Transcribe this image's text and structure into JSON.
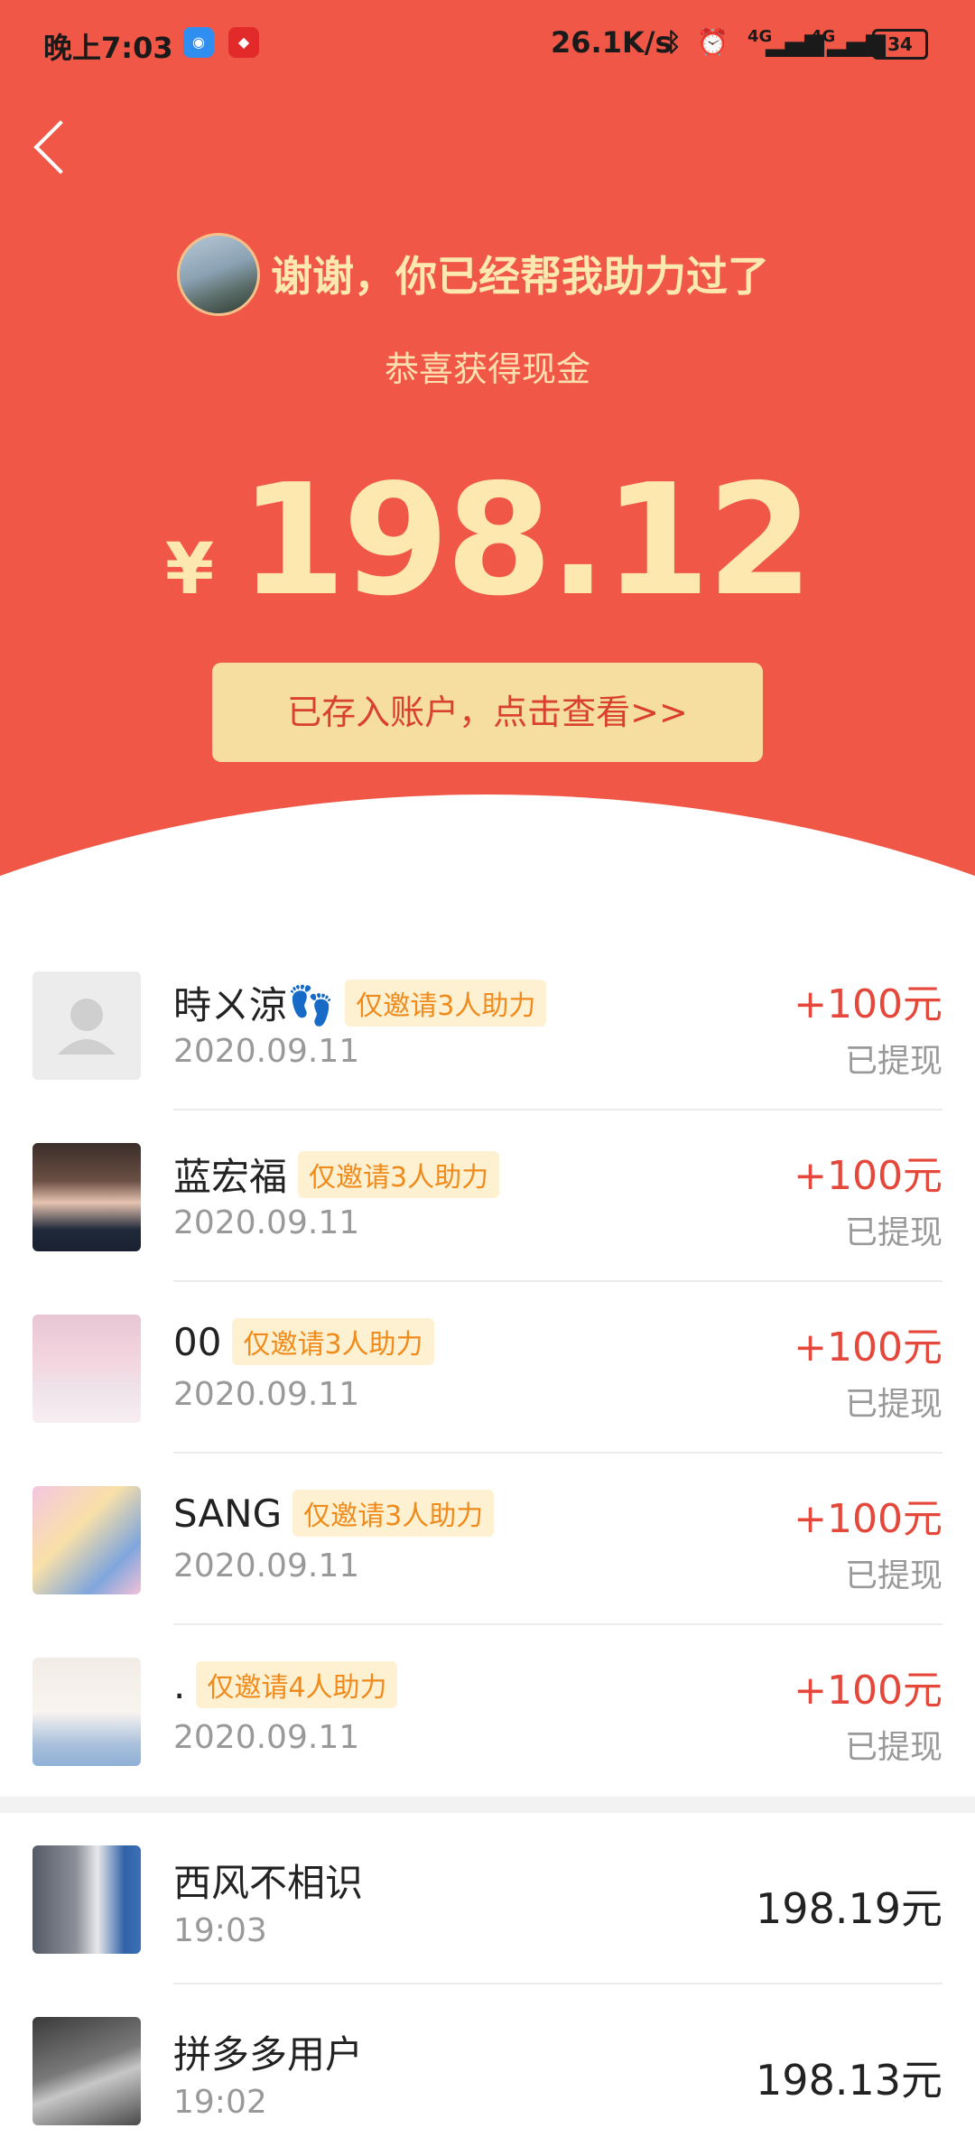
{
  "status_bar": {
    "time": "晚上7:03",
    "speed": "26.1K/s",
    "bluetooth": "bluetooth-icon",
    "alarm": "alarm-icon",
    "network1": "4G",
    "network2": "4G",
    "battery": "34"
  },
  "header": {
    "headline": "谢谢，你已经帮我助力过了",
    "subtitle": "恭喜获得现金",
    "currency": "¥",
    "amount": "198.12",
    "button": "已存入账户，点击查看>>"
  },
  "helpers": [
    {
      "name": "時ㄨ涼👣",
      "tag": "仅邀请3人助力",
      "date": "2020.09.11",
      "reward": "+100元",
      "status": "已提现"
    },
    {
      "name": "蓝宏福",
      "tag": "仅邀请3人助力",
      "date": "2020.09.11",
      "reward": "+100元",
      "status": "已提现"
    },
    {
      "name": "00",
      "tag": "仅邀请3人助力",
      "date": "2020.09.11",
      "reward": "+100元",
      "status": "已提现"
    },
    {
      "name": "SANG",
      "tag": "仅邀请3人助力",
      "date": "2020.09.11",
      "reward": "+100元",
      "status": "已提现"
    },
    {
      "name": ".",
      "tag": "仅邀请4人助力",
      "date": "2020.09.11",
      "reward": "+100元",
      "status": "已提现"
    }
  ],
  "winners": [
    {
      "name": "西风不相识",
      "time": "19:03",
      "amount": "198.19元"
    },
    {
      "name": "拼多多用户",
      "time": "19:02",
      "amount": "198.13元"
    }
  ],
  "colors": {
    "header_red": "#f05746",
    "gold_text": "#fde8b0",
    "button_bg": "#f6dea0",
    "reward_red": "#e5473a",
    "tag_orange": "#f08a1a"
  }
}
